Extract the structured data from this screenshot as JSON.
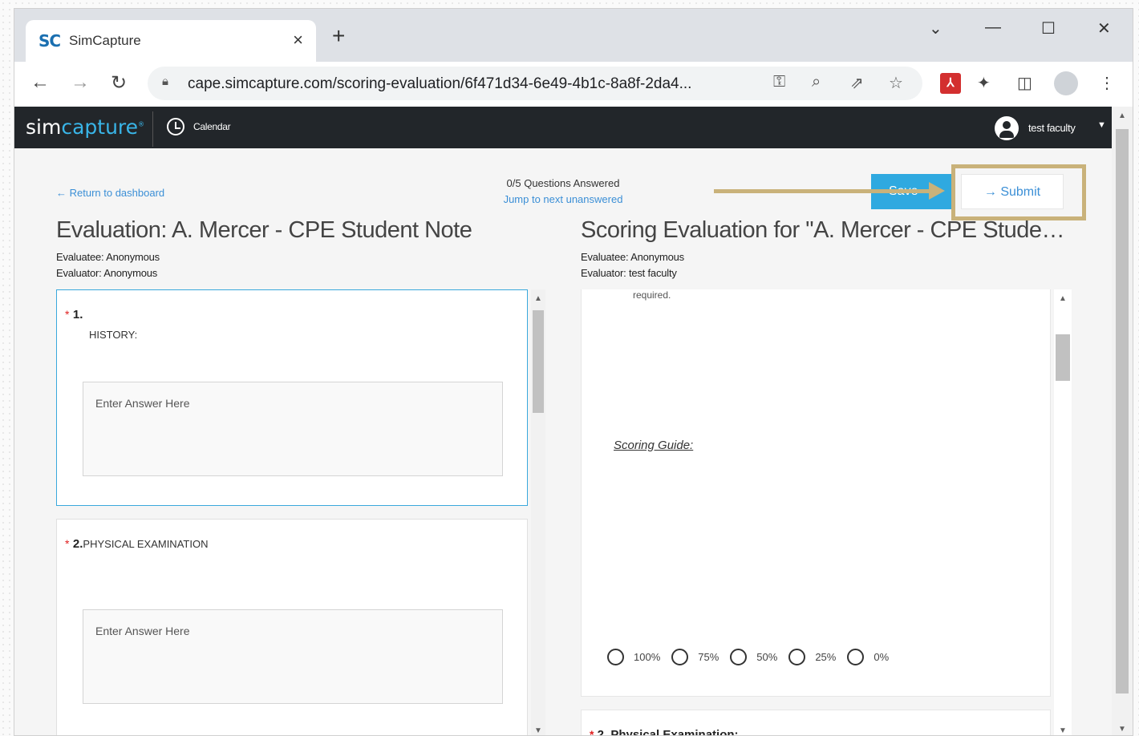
{
  "browser": {
    "tab": {
      "favicon": "SC",
      "title": "SimCapture",
      "close": "×"
    },
    "new_tab": "+",
    "window_controls": {
      "menu": "⌄",
      "minimize": "—",
      "maximize": "☐",
      "close": "✕"
    },
    "url": "cape.simcapture.com/scoring-evaluation/6f471d34-6e49-4b1c-8a8f-2da4..."
  },
  "app": {
    "logo_prefix": "sim",
    "logo_suffix": "capture",
    "logo_mark": "®",
    "nav_calendar": "Calendar",
    "user_name": "test faculty"
  },
  "header": {
    "return_link": "← Return to dashboard",
    "progress": "0/5 Questions Answered",
    "jump_link": "Jump to next unanswered",
    "save_label": "Save",
    "submit_label": "→  Submit"
  },
  "evaluation": {
    "title": "Evaluation: A. Mercer - CPE Student Note",
    "evaluatee": "Evaluatee: Anonymous",
    "evaluator": "Evaluator: Anonymous",
    "questions": [
      {
        "marker": "*",
        "number": "1.",
        "label": "HISTORY:",
        "placeholder": "Enter Answer Here"
      },
      {
        "marker": "*",
        "number": "2.",
        "label": "PHYSICAL EXAMINATION",
        "placeholder": "Enter Answer Here"
      }
    ]
  },
  "scoring": {
    "title": "Scoring Evaluation for \"A. Mercer - CPE Studen...",
    "evaluatee": "Evaluatee: Anonymous",
    "evaluator": "Evaluator: test faculty",
    "fragment": "required.",
    "guide_label": "Scoring Guide:",
    "options": [
      "100%",
      "75%",
      "50%",
      "25%",
      "0%"
    ],
    "next_marker": "*",
    "next_number": "2.",
    "next_title": "Physical Examination:"
  },
  "colors": {
    "accent": "#2fa9e0",
    "link": "#3b8fd6",
    "annotation": "#c9b27a",
    "navbar": "#22262a"
  }
}
